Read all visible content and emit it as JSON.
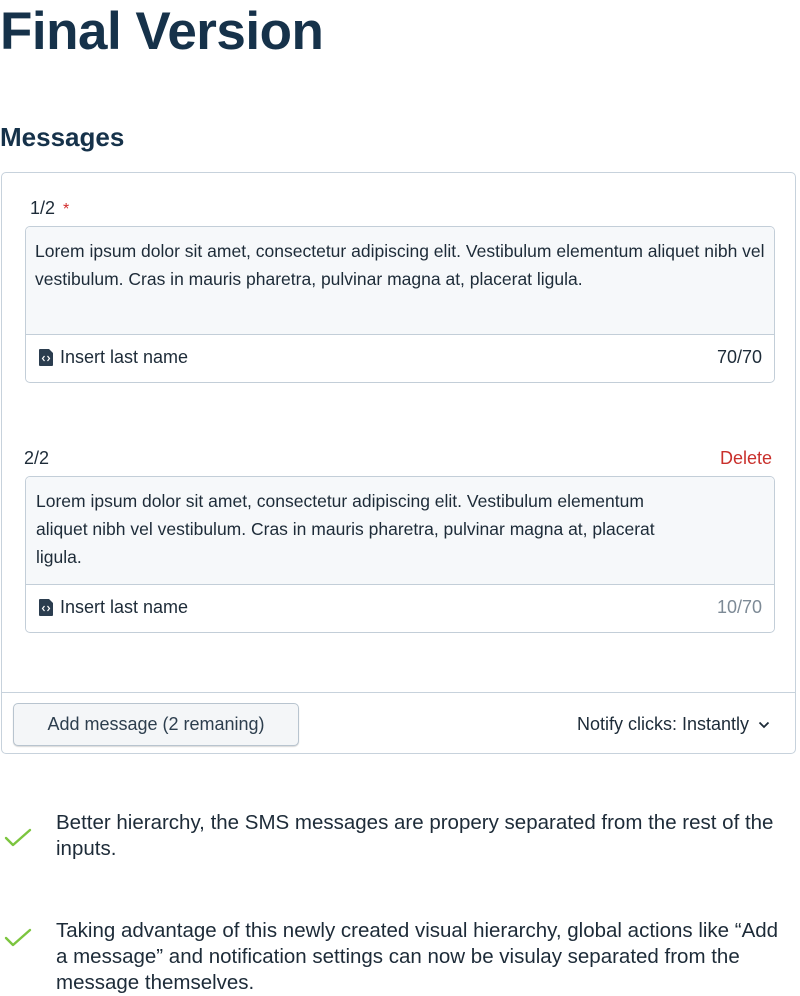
{
  "page": {
    "title": "Final Version",
    "section_title": "Messages"
  },
  "messages": [
    {
      "label": "1/2",
      "required_mark": "*",
      "text": "Lorem ipsum dolor sit amet, consectetur adipiscing elit. Vestibulum elementum aliquet nibh vel vestibulum. Cras in mauris pharetra, pulvinar magna at, placerat ligula.",
      "insert_label": "Insert last name",
      "count": "70/70"
    },
    {
      "label": "2/2",
      "delete_label": "Delete",
      "text": "Lorem ipsum dolor sit amet, consectetur adipiscing elit. Vestibulum elementum aliquet nibh vel vestibulum. Cras in mauris pharetra, pulvinar magna at, placerat ligula.",
      "insert_label": "Insert last name",
      "count": "10/70"
    }
  ],
  "footer": {
    "add_button": "Add message (2 remaning)",
    "notify_label": "Notify clicks: Instantly"
  },
  "notes": [
    "Better hierarchy, the SMS messages are propery separated from the rest of the inputs.",
    "Taking advantage of this newly created visual hierarchy, global actions like “Add a message” and notification settings can now be visulay separated from the message themselves."
  ],
  "colors": {
    "heading": "#16324a",
    "delete": "#c9302c",
    "required": "#d12b2b",
    "check": "#7cc53f",
    "border": "#c7d2dc"
  },
  "icons": [
    "code-file-icon",
    "chevron-down-icon",
    "checkmark-icon"
  ]
}
